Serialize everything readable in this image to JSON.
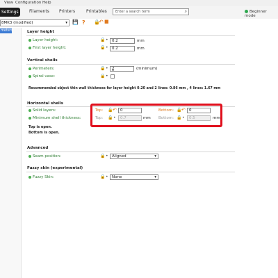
{
  "menubar": {
    "view": "View",
    "configuration": "Configuration",
    "help": "Help"
  },
  "tabs": {
    "settings": "Settings",
    "filaments": "Filaments",
    "printers": "Printers",
    "printables": "Printables"
  },
  "search": {
    "placeholder": "Enter a search term"
  },
  "mode": {
    "label": "Beginner mode"
  },
  "preset": {
    "value": "8MK3 (modified)"
  },
  "sidebar": {
    "selected": "meters"
  },
  "layer_height": {
    "title": "Layer height",
    "layer_height_label": "Layer height:",
    "layer_height_value": "0.2",
    "first_layer_label": "First layer height:",
    "first_layer_value": "0.2",
    "unit": "mm"
  },
  "vertical_shells": {
    "title": "Vertical shells",
    "perimeters_label": "Perimeters:",
    "perimeters_value": "2",
    "perimeters_unit": "(minimum)",
    "spiral_label": "Spiral vase:",
    "note": "Recommended object thin wall thickness for layer height 0.20 and 2 lines: 0.86 mm , 4 lines: 1.67 mm"
  },
  "horizontal_shells": {
    "title": "Horizontal shells",
    "solid_label": "Solid layers:",
    "min_thickness_label": "Minimum shell thickness:",
    "top_label": "Top:",
    "bottom_label": "Bottom:",
    "top_solid_value": "0",
    "bottom_solid_value": "0",
    "top_thickness_value": "0.7",
    "bottom_thickness_value": "0.5",
    "unit": "mm",
    "note_top": "Top is open.",
    "note_bottom": "Bottom is open."
  },
  "advanced": {
    "title": "Advanced",
    "seam_label": "Seam position:",
    "seam_value": "Aligned"
  },
  "fuzzy": {
    "title": "Fuzzy skin (experimental)",
    "fuzzy_label": "Fuzzy Skin:",
    "fuzzy_value": "None"
  },
  "colors": {
    "accent_red": "#e0101d",
    "modified_orange": "#e07a1f",
    "ok_green": "#2fa84f"
  }
}
